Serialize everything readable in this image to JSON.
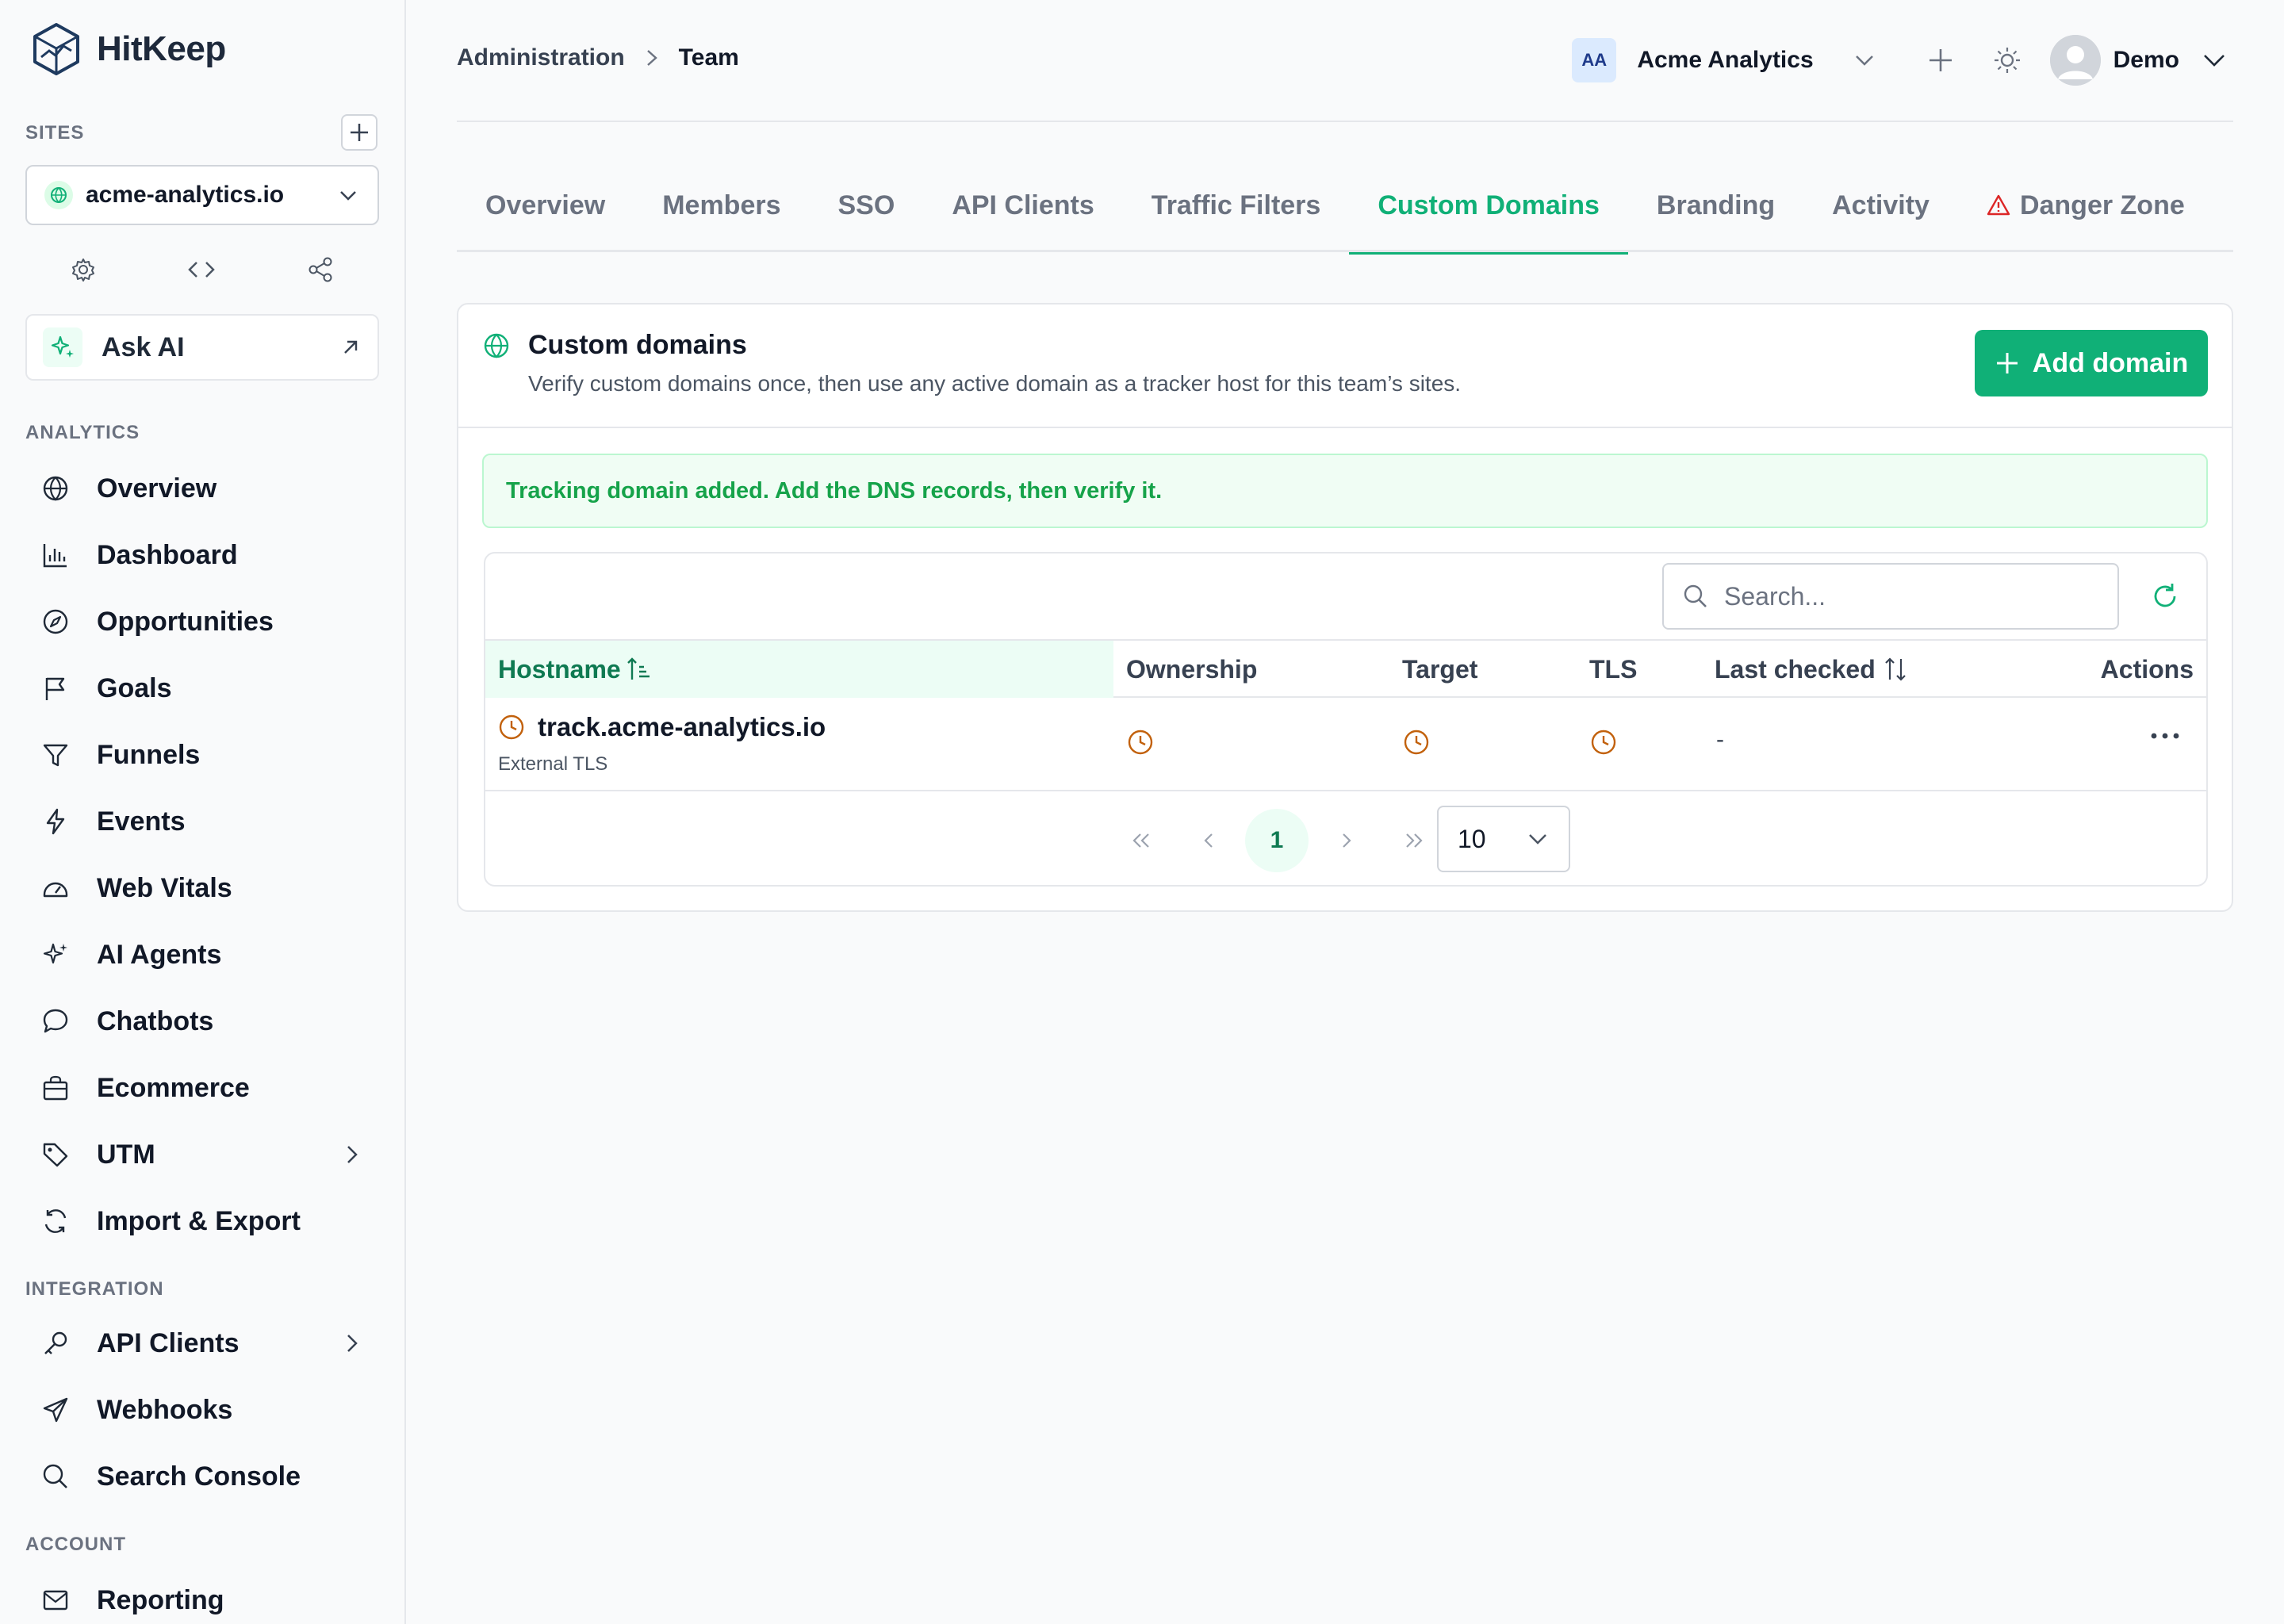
{
  "brand": {
    "name": "HitKeep"
  },
  "sidebar": {
    "sites_label": "SITES",
    "site_selected": "acme-analytics.io",
    "ask_ai": "Ask AI",
    "sections": [
      {
        "label": "ANALYTICS"
      },
      {
        "label": "INTEGRATION"
      },
      {
        "label": "ACCOUNT"
      }
    ],
    "analytics_items": [
      {
        "label": "Overview",
        "icon": "globe-icon"
      },
      {
        "label": "Dashboard",
        "icon": "bar-chart-icon"
      },
      {
        "label": "Opportunities",
        "icon": "compass-icon"
      },
      {
        "label": "Goals",
        "icon": "flag-icon"
      },
      {
        "label": "Funnels",
        "icon": "filter-icon"
      },
      {
        "label": "Events",
        "icon": "bolt-icon"
      },
      {
        "label": "Web Vitals",
        "icon": "gauge-icon"
      },
      {
        "label": "AI Agents",
        "icon": "sparkles-icon"
      },
      {
        "label": "Chatbots",
        "icon": "chat-icon"
      },
      {
        "label": "Ecommerce",
        "icon": "bag-icon"
      },
      {
        "label": "UTM",
        "icon": "tag-icon"
      },
      {
        "label": "Import & Export",
        "icon": "sync-icon"
      }
    ],
    "integration_items": [
      {
        "label": "API Clients",
        "icon": "key-icon"
      },
      {
        "label": "Webhooks",
        "icon": "send-icon"
      },
      {
        "label": "Search Console",
        "icon": "search-icon"
      }
    ],
    "account_items": [
      {
        "label": "Reporting",
        "icon": "mail-icon"
      }
    ]
  },
  "header": {
    "breadcrumb": [
      "Administration",
      "Team"
    ],
    "team_initials": "AA",
    "team_name": "Acme Analytics",
    "user_name": "Demo"
  },
  "tabs": [
    {
      "label": "Overview"
    },
    {
      "label": "Members"
    },
    {
      "label": "SSO"
    },
    {
      "label": "API Clients"
    },
    {
      "label": "Traffic Filters"
    },
    {
      "label": "Custom Domains",
      "active": true
    },
    {
      "label": "Branding"
    },
    {
      "label": "Activity"
    },
    {
      "label": "Danger Zone",
      "warning": true
    }
  ],
  "card": {
    "title": "Custom domains",
    "description": "Verify custom domains once, then use any active domain as a tracker host for this team’s sites.",
    "add_button": "Add domain",
    "alert": "Tracking domain added. Add the DNS records, then verify it."
  },
  "table": {
    "search_placeholder": "Search...",
    "columns": [
      "Hostname",
      "Ownership",
      "Target",
      "TLS",
      "Last checked",
      "Actions"
    ],
    "rows": [
      {
        "hostname": "track.acme-analytics.io",
        "subtitle": "External TLS",
        "ownership": "pending",
        "target": "pending",
        "tls": "pending",
        "last_checked": "-"
      }
    ],
    "pagination": {
      "current_page": "1",
      "per_page": "10"
    }
  },
  "colors": {
    "accent": "#10b077",
    "pending": "#c2610c",
    "danger": "#dc2626",
    "alert_bg": "#f0fdf4"
  }
}
